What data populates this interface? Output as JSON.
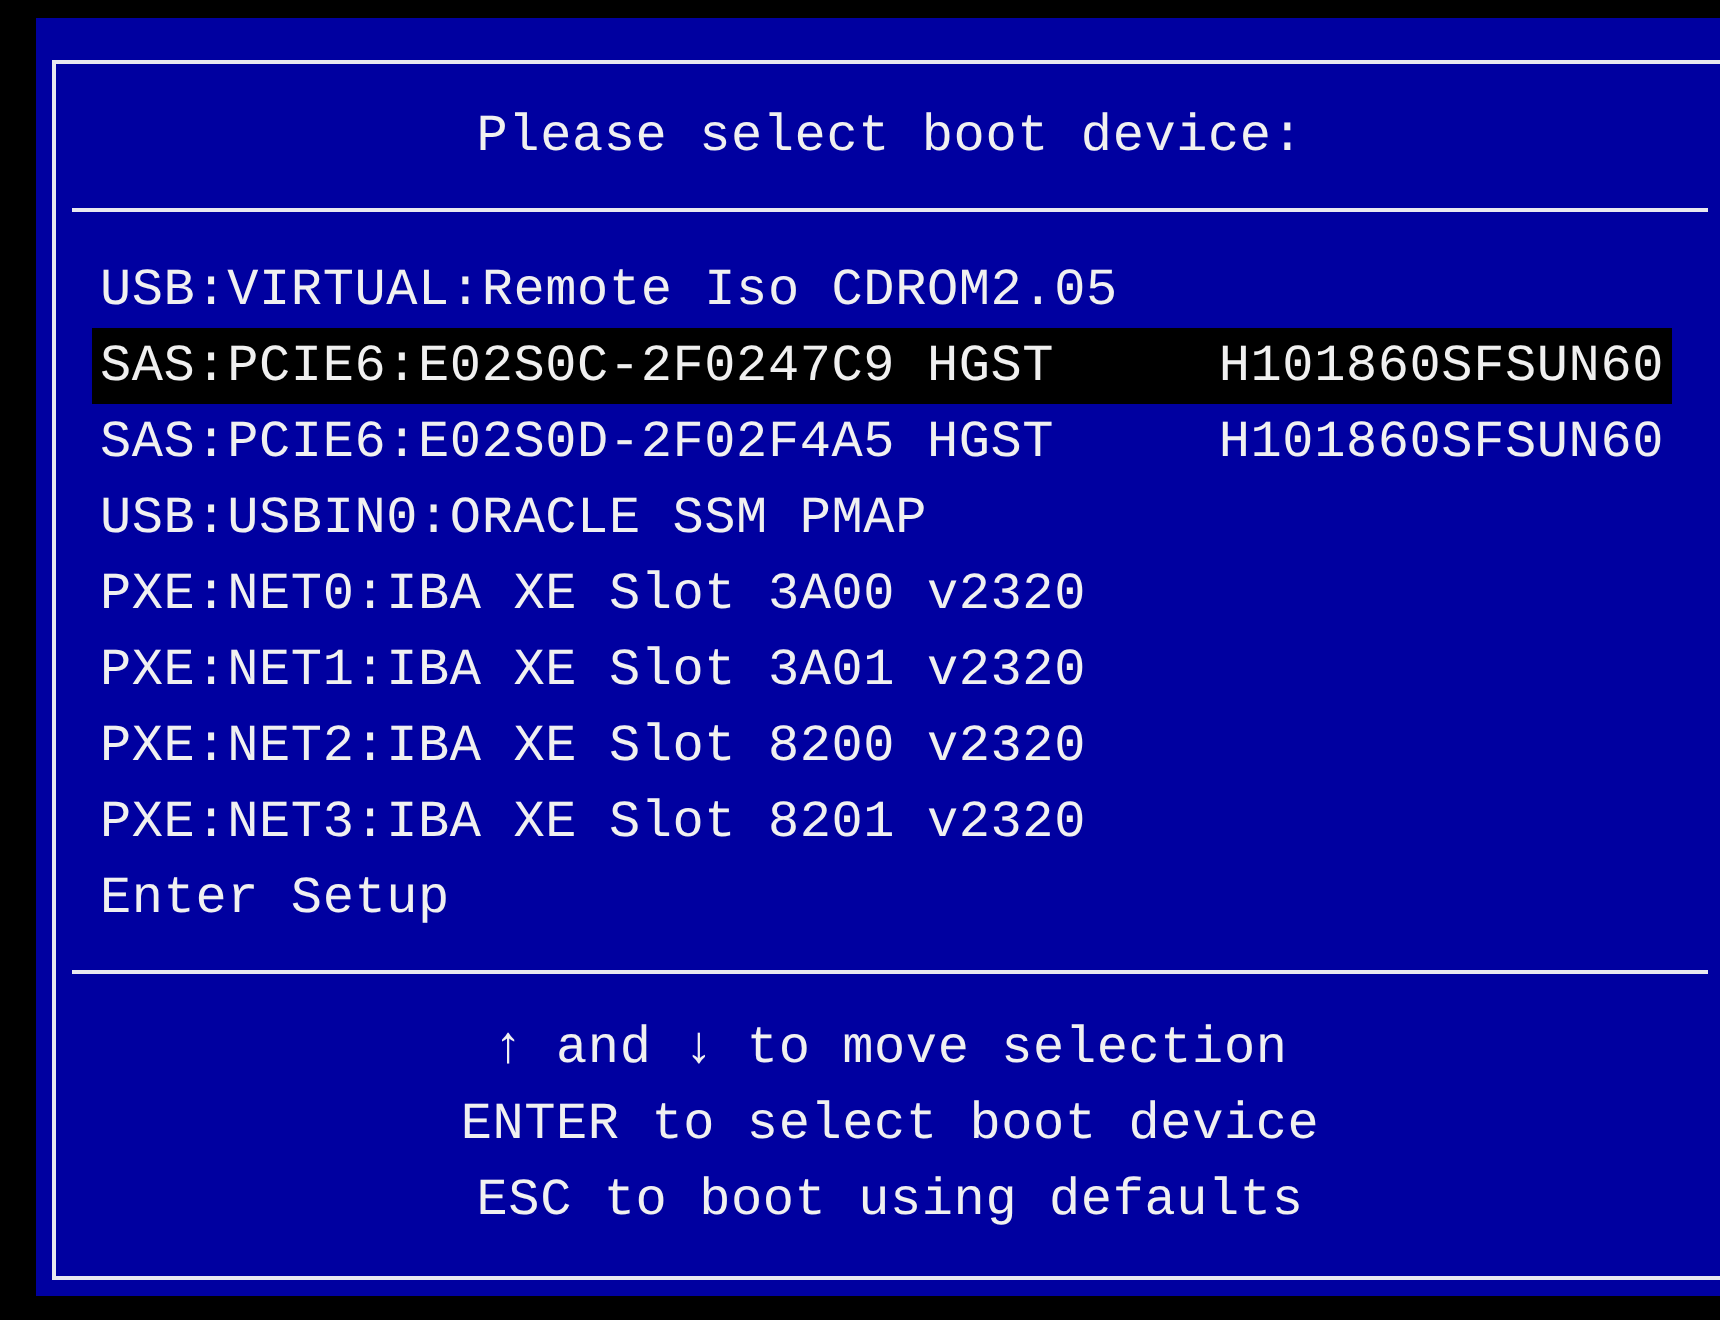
{
  "title": "Please select boot device:",
  "devices": [
    {
      "label": "USB:VIRTUAL:Remote Iso CDROM2.05",
      "selected": false
    },
    {
      "label": "SAS:PCIE6:E02S0C-2F0247C9 HGST",
      "detail": "H101860SFSUN60",
      "selected": true
    },
    {
      "label": "SAS:PCIE6:E02S0D-2F02F4A5 HGST",
      "detail": "H101860SFSUN60",
      "selected": false
    },
    {
      "label": "USB:USBIN0:ORACLE SSM PMAP",
      "selected": false
    },
    {
      "label": "PXE:NET0:IBA XE Slot 3A00 v2320",
      "selected": false
    },
    {
      "label": "PXE:NET1:IBA XE Slot 3A01 v2320",
      "selected": false
    },
    {
      "label": "PXE:NET2:IBA XE Slot 8200 v2320",
      "selected": false
    },
    {
      "label": "PXE:NET3:IBA XE Slot 8201 v2320",
      "selected": false
    },
    {
      "label": "Enter Setup",
      "selected": false
    }
  ],
  "help": [
    "↑ and ↓ to move selection",
    "ENTER to select boot device",
    "ESC to boot using defaults"
  ]
}
